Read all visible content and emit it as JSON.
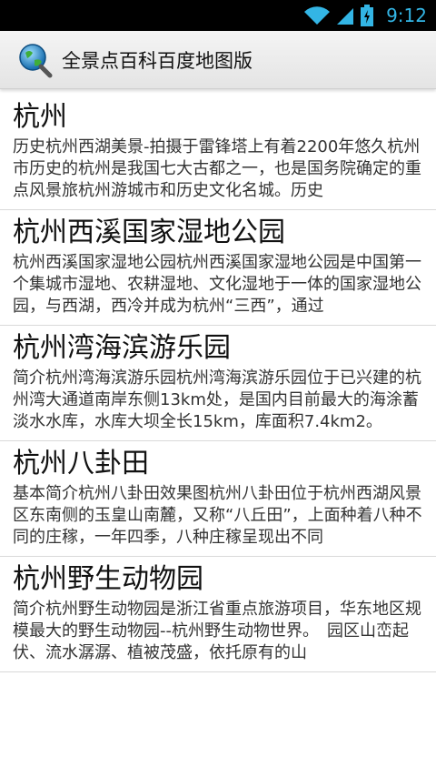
{
  "status": {
    "time": "9:12",
    "clock_color": "#33b5e5"
  },
  "app": {
    "title": "全景点百科百度地图版",
    "icon": "globe-search-icon"
  },
  "items": [
    {
      "title": "杭州",
      "desc": "历史杭州西湖美景-拍摄于雷锋塔上有着2200年悠久杭州市历史的杭州是我国七大古都之一，也是国务院确定的重点风景旅杭州游城市和历史文化名城。历史"
    },
    {
      "title": "杭州西溪国家湿地公园",
      "desc": "杭州西溪国家湿地公园杭州西溪国家湿地公园是中国第一个集城市湿地、农耕湿地、文化湿地于一体的国家湿地公园，与西湖，西冷并成为杭州“三西”，通过"
    },
    {
      "title": "杭州湾海滨游乐园",
      "desc": "简介杭州湾海滨游乐园杭州湾海滨游乐园位于已兴建的杭州湾大通道南岸东侧13km处，是国内目前最大的海涂蓄淡水水库，水库大坝全长15km，库面积7.4km2。"
    },
    {
      "title": "杭州八卦田",
      "desc": "基本简介杭州八卦田效果图杭州八卦田位于杭州西湖风景区东南侧的玉皇山南麓，又称“八丘田”，上面种着八种不同的庄稼，一年四季，八种庄稼呈现出不同"
    },
    {
      "title": "杭州野生动物园",
      "desc": "简介杭州野生动物园是浙江省重点旅游项目，华东地区规模最大的野生动物园--杭州野生动物世界。　园区山峦起伏、流水潺潺、植被茂盛，依托原有的山"
    }
  ]
}
